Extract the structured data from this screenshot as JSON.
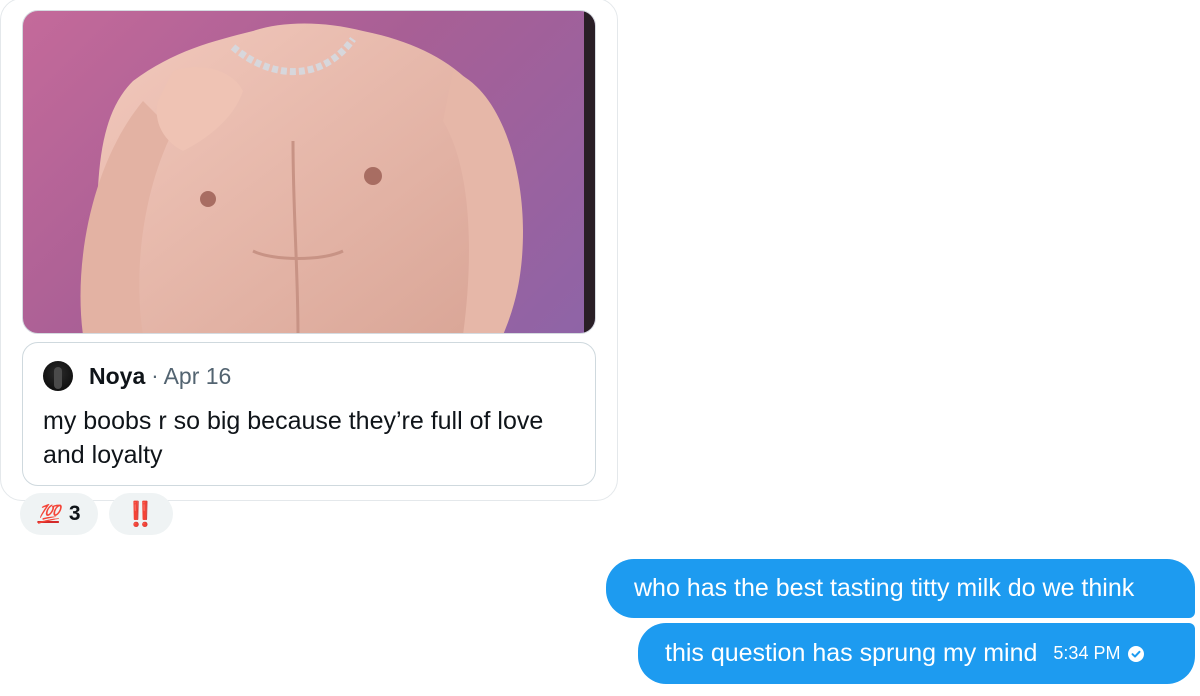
{
  "shared_post": {
    "media": {
      "icon": "photo-shirtless-torso"
    },
    "quoted_tweet": {
      "author": "Noya",
      "separator": "·",
      "date": "Apr 16",
      "text": "my boobs r so big because they’re full of love and loyalty"
    },
    "reactions": [
      {
        "emoji": "💯",
        "count": "3"
      },
      {
        "emoji": "‼️",
        "count": ""
      }
    ]
  },
  "messages": [
    {
      "text": "who has the best tasting titty milk do we think"
    },
    {
      "text": "this question has sprung my mind",
      "time": "5:34 PM",
      "status_icon": "check-circle-icon"
    }
  ],
  "colors": {
    "bubble": "#1d9bf0",
    "reaction_bg": "#eff3f4",
    "border": "#cfd9de"
  }
}
